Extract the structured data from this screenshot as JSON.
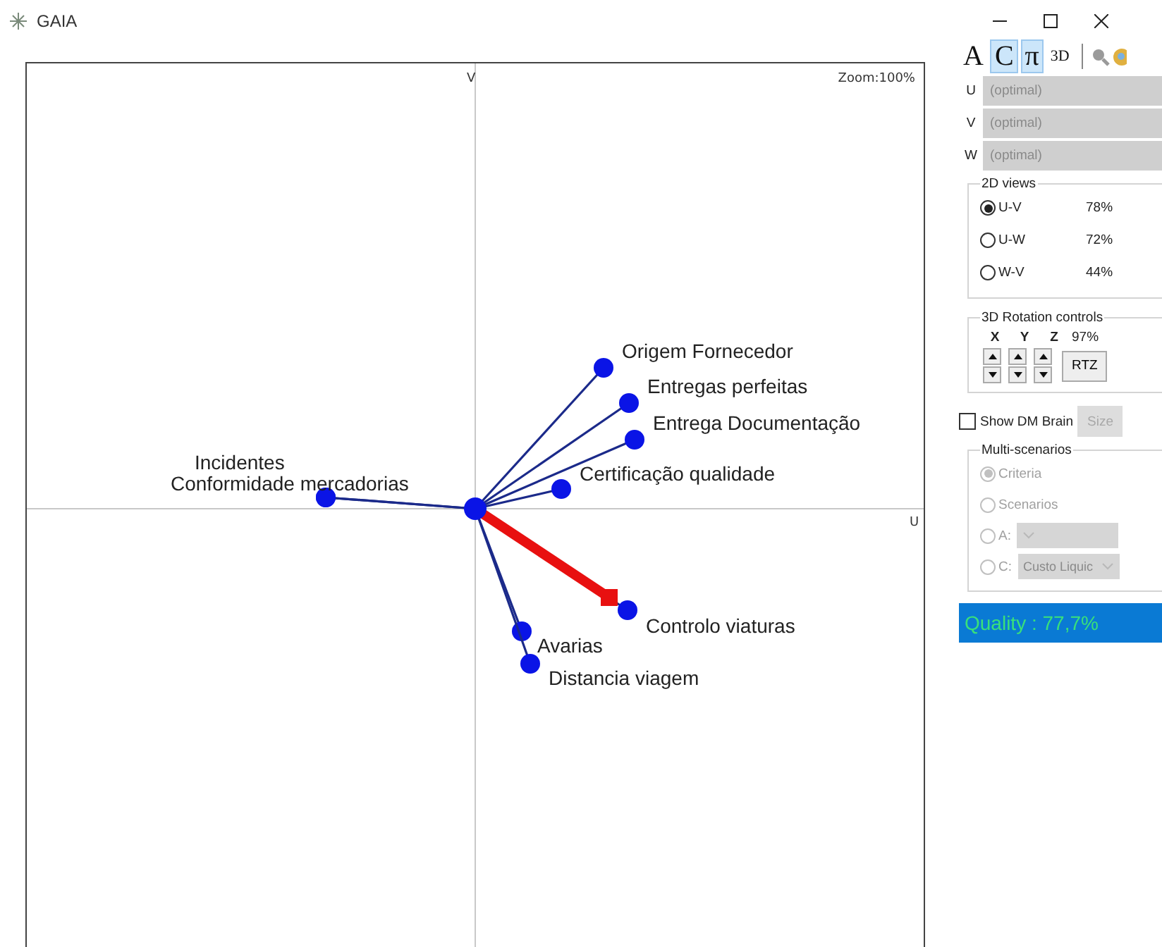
{
  "window": {
    "title": "GAIA"
  },
  "plot": {
    "vertical_axis": "V",
    "horizontal_axis": "U",
    "zoom": "Zoom:100%",
    "criteria": [
      {
        "label": "Incidentes"
      },
      {
        "label": "Conformidade mercadorias"
      },
      {
        "label": "Origem Fornecedor"
      },
      {
        "label": "Entregas perfeitas"
      },
      {
        "label": "Entrega Documentação"
      },
      {
        "label": "Certificação qualidade"
      },
      {
        "label": "Controlo viaturas"
      },
      {
        "label": "Avarias"
      },
      {
        "label": "Distancia viagem"
      }
    ]
  },
  "toolbar": [
    {
      "label": "A",
      "selected": false
    },
    {
      "label": "C",
      "selected": true
    },
    {
      "label": "π",
      "selected": true
    },
    {
      "label": "3D",
      "selected": false
    }
  ],
  "axes": [
    {
      "label": "U",
      "value": "(optimal)",
      "disabled": true
    },
    {
      "label": "V",
      "value": "(optimal)",
      "disabled": true
    },
    {
      "label": "W",
      "value": "(optimal)",
      "disabled": true
    }
  ],
  "views_2d": {
    "title": "2D views",
    "options": [
      {
        "label": "U-V",
        "value": "78%",
        "selected": true
      },
      {
        "label": "U-W",
        "value": "72%",
        "selected": false
      },
      {
        "label": "W-V",
        "value": "44%",
        "selected": false
      }
    ]
  },
  "rotation": {
    "title": "3D Rotation controls",
    "axes": [
      "X",
      "Y",
      "Z"
    ],
    "value": "97%",
    "reset": "RTZ"
  },
  "dm_brain": {
    "label": "Show DM Brain",
    "checked": false
  },
  "size_button": {
    "label": "Size",
    "disabled": true
  },
  "multi_scenarios": {
    "title": "Multi-scenarios",
    "options": [
      {
        "kind": "radio",
        "label": "Criteria",
        "selected": true,
        "disabled": true
      },
      {
        "kind": "radio",
        "label": "Scenarios",
        "selected": false,
        "disabled": true
      },
      {
        "kind": "combo",
        "label": "A:",
        "selected": false,
        "disabled": true
      },
      {
        "kind": "combo",
        "label": "C:",
        "value": "Custo Liquic",
        "selected": false,
        "disabled": true
      }
    ]
  },
  "quality": "Quality : 77,7%"
}
